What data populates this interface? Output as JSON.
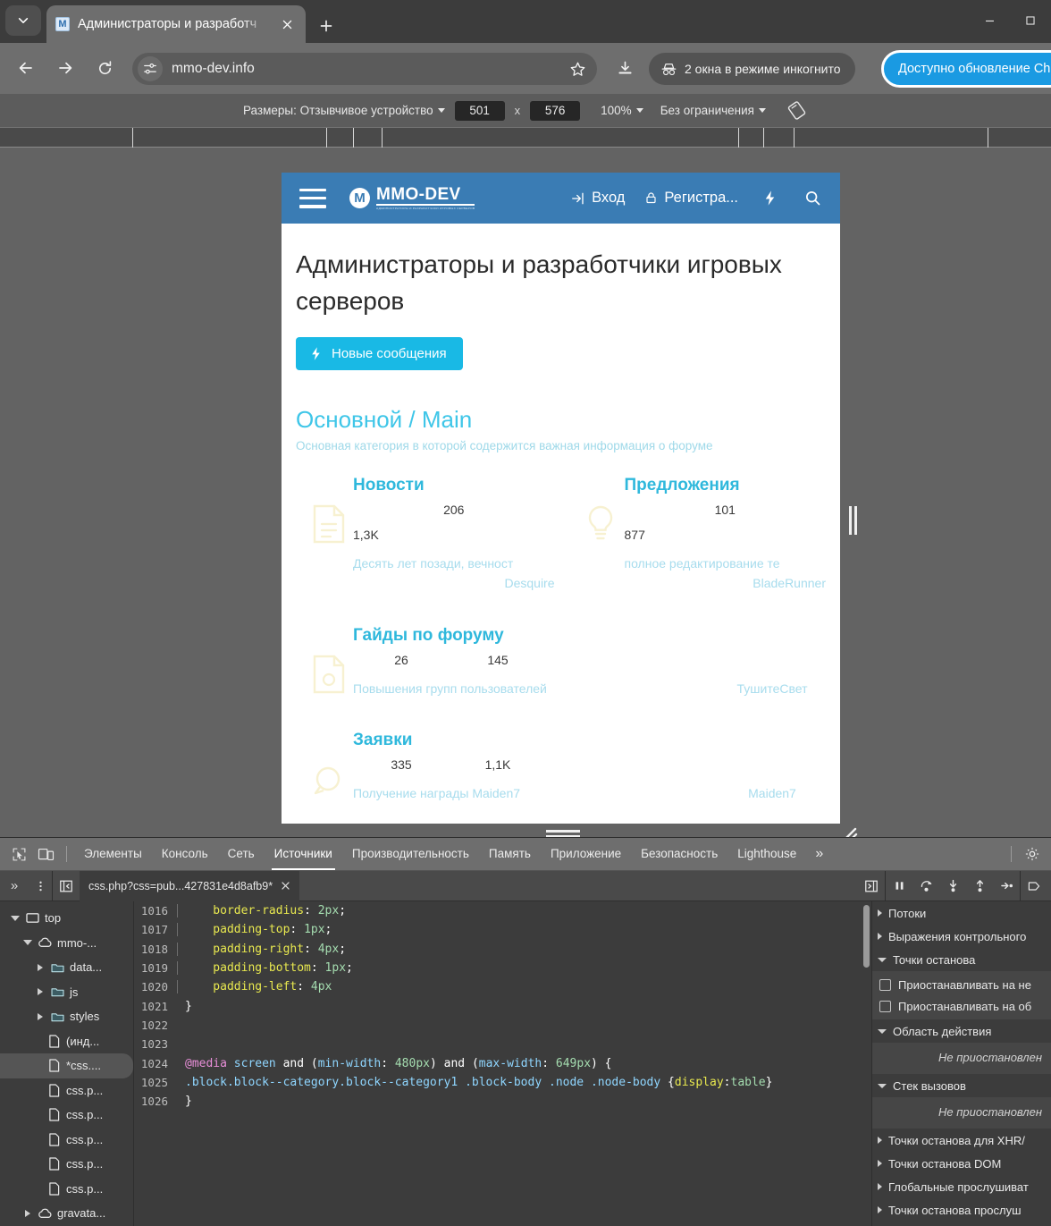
{
  "browser": {
    "tab": {
      "title": "Администраторы и разработч",
      "favicon_letter": "M"
    },
    "new_tab_label": "+",
    "url": "mmo-dev.info",
    "incognito_label": "2 окна в режиме инкогнито",
    "update_label": "Доступно обновление Ch",
    "window_minimize": "—",
    "window_maximize": "▢"
  },
  "device_toolbar": {
    "dimensions_label": "Размеры: Отзывчивое устройство",
    "width": "501",
    "height": "576",
    "x_separator": "x",
    "zoom": "100%",
    "throttling": "Без ограничения"
  },
  "site": {
    "header": {
      "logo_title": "MMO-DEV",
      "logo_subtitle": "АДМИНИСТРАТОРЫ И РАЗРАБОТЧИКИ ИГРОВЫХ СЕРВЕРОВ",
      "logo_mark": "M",
      "login": "Вход",
      "register": "Регистра..."
    },
    "page_title": "Администраторы и разработчики игровых серверов",
    "new_posts_button": "Новые сообщения",
    "category": {
      "title": "Основной / Main",
      "description": "Основная категория в которой содержится важная информация о форуме"
    },
    "nodes": [
      {
        "title": "Новости",
        "threads": "206",
        "messages": "1,3K",
        "last_title": "Десять лет позади, вечност",
        "last_author": "Desquire"
      },
      {
        "title": "Предложения",
        "threads": "101",
        "messages": "877",
        "last_title": "полное редактирование те",
        "last_author": "BladeRunner"
      },
      {
        "title": "Гайды по форуму",
        "threads": "26",
        "messages": "145",
        "last_title": "Повышения групп пользователей",
        "last_author": "ТушитеСвет"
      },
      {
        "title": "Заявки",
        "threads": "335",
        "messages": "1,1K",
        "last_title": "Получение награды Maiden7",
        "last_author": "Maiden7"
      }
    ]
  },
  "devtools": {
    "tabs": [
      {
        "label": "Элементы",
        "active": false
      },
      {
        "label": "Консоль",
        "active": false
      },
      {
        "label": "Сеть",
        "active": false
      },
      {
        "label": "Источники",
        "active": true
      },
      {
        "label": "Производительность",
        "active": false
      },
      {
        "label": "Память",
        "active": false
      },
      {
        "label": "Приложение",
        "active": false
      },
      {
        "label": "Безопасность",
        "active": false
      },
      {
        "label": "Lighthouse",
        "active": false
      }
    ],
    "more_tabs": "»",
    "source_tab": "css.php?css=pub...427831e4d8afb9*",
    "file_tree": [
      {
        "label": "top",
        "depth": 0,
        "icon": "frame",
        "twisty": "open",
        "selected": false
      },
      {
        "label": "mmo-...",
        "depth": 1,
        "icon": "cloud",
        "twisty": "open",
        "selected": false
      },
      {
        "label": "data...",
        "depth": 2,
        "icon": "folder",
        "twisty": "closed",
        "selected": false
      },
      {
        "label": "js",
        "depth": 2,
        "icon": "folder",
        "twisty": "closed",
        "selected": false
      },
      {
        "label": "styles",
        "depth": 2,
        "icon": "folder",
        "twisty": "closed",
        "selected": false
      },
      {
        "label": "(инд...",
        "depth": 3,
        "icon": "file",
        "twisty": "none",
        "selected": false
      },
      {
        "label": "*css....",
        "depth": 3,
        "icon": "file",
        "twisty": "none",
        "selected": true
      },
      {
        "label": "css.p...",
        "depth": 3,
        "icon": "file",
        "twisty": "none",
        "selected": false
      },
      {
        "label": "css.p...",
        "depth": 3,
        "icon": "file",
        "twisty": "none",
        "selected": false
      },
      {
        "label": "css.p...",
        "depth": 3,
        "icon": "file",
        "twisty": "none",
        "selected": false
      },
      {
        "label": "css.p...",
        "depth": 3,
        "icon": "file",
        "twisty": "none",
        "selected": false
      },
      {
        "label": "css.p...",
        "depth": 3,
        "icon": "file",
        "twisty": "none",
        "selected": false
      },
      {
        "label": "gravata...",
        "depth": 1,
        "icon": "cloud",
        "twisty": "closed",
        "selected": false
      }
    ],
    "code_lines": [
      {
        "n": "1016",
        "indent": true,
        "text": "    border-radius: 2px;"
      },
      {
        "n": "1017",
        "indent": true,
        "text": "    padding-top: 1px;"
      },
      {
        "n": "1018",
        "indent": true,
        "text": "    padding-right: 4px;"
      },
      {
        "n": "1019",
        "indent": true,
        "text": "    padding-bottom: 1px;"
      },
      {
        "n": "1020",
        "indent": true,
        "text": "    padding-left: 4px"
      },
      {
        "n": "1021",
        "indent": false,
        "text": "}"
      },
      {
        "n": "1022",
        "indent": false,
        "text": ""
      },
      {
        "n": "1023",
        "indent": false,
        "text": ""
      },
      {
        "n": "1024",
        "indent": false,
        "text": "@media screen and (min-width: 480px) and (max-width: 649px) {"
      },
      {
        "n": "1025",
        "indent": false,
        "text": ".block.block--category.block--category1 .block-body .node .node-body {display:table}"
      },
      {
        "n": "1026",
        "indent": false,
        "text": "}"
      }
    ],
    "sidebar": {
      "threads": "Потоки",
      "watch": "Выражения контрольного",
      "breakpoints": "Точки останова",
      "pause_uncaught": "Приостанавливать на не",
      "pause_caught": "Приостанавливать на об",
      "scope": "Область действия",
      "scope_empty": "Не приостановлен",
      "call_stack": "Стек вызовов",
      "call_stack_empty": "Не приостановлен",
      "xhr_breakpoints": "Точки останова для XHR/",
      "dom_breakpoints": "Точки останова DOM",
      "global_listeners": "Глобальные прослушиват",
      "event_listener_breakpoints": "Точки останова прослуш"
    }
  },
  "colors": {
    "chrome_bg": "#3c3c3c",
    "toolbar_bg": "#6e6e6e",
    "accent_blue": "#1a9ae2",
    "site_header": "#3a7cb4",
    "site_accent": "#19b9e5",
    "node_title": "#2fb8dc",
    "category_title": "#3fc6e8"
  }
}
